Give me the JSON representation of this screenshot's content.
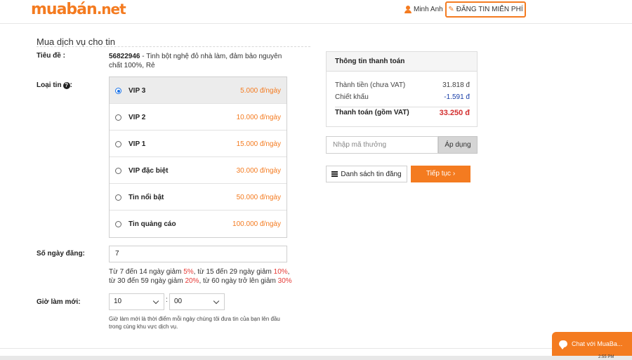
{
  "header": {
    "logo_main": "muabán",
    "logo_tld": ".net",
    "user_name": "Minh Anh",
    "post_button": "ĐĂNG TIN MIỄN PHÍ"
  },
  "page": {
    "title": "Mua dịch vụ cho tin"
  },
  "form": {
    "title_label": "Tiêu đề :",
    "title_id": "56822946",
    "title_text": " - Tinh bột nghệ đỏ nhà làm, đảm bảo nguyên chất 100%, Rẻ",
    "type_label": "Loại tin",
    "options": [
      {
        "name": "VIP 3",
        "price": "5.000 đ/ngày",
        "selected": true
      },
      {
        "name": "VIP 2",
        "price": "10.000 đ/ngày",
        "selected": false
      },
      {
        "name": "VIP 1",
        "price": "15.000 đ/ngày",
        "selected": false
      },
      {
        "name": "VIP đặc biệt",
        "price": "30.000 đ/ngày",
        "selected": false
      },
      {
        "name": "Tin nổi bật",
        "price": "50.000 đ/ngày",
        "selected": false
      },
      {
        "name": "Tin quảng cáo",
        "price": "100.000 đ/ngày",
        "selected": false
      }
    ],
    "days_label": "Số ngày đăng:",
    "days_value": "7",
    "discount": {
      "t1": "Từ 7 đến 14 ngày giảm ",
      "p1": "5%",
      "t2": ", từ 15 đến 29 ngày giảm ",
      "p2": "10%",
      "t3": ", từ 30 đến 59 ngày giảm ",
      "p3": "20%",
      "t4": ", từ 60 ngày trở lên giảm ",
      "p4": "30%"
    },
    "refresh_label": "Giờ làm mới:",
    "hour_value": "10",
    "minute_value": "00",
    "colon": ":",
    "refresh_note": "Giờ làm mới là thời điểm mỗi ngày chúng tôi đưa tin của bạn lên đầu trong cùng khu vực dịch vụ."
  },
  "payment": {
    "heading": "Thông tin thanh toán",
    "subtotal_label": "Thành tiền (chưa VAT)",
    "subtotal_value": "31.818 đ",
    "discount_label": "Chiết khấu",
    "discount_value": "-1.591 đ",
    "total_label": "Thanh toán (gồm VAT)",
    "total_value": "33.250 đ",
    "coupon_placeholder": "Nhập mã thưởng",
    "apply_button": "Áp dụng",
    "list_button": "Danh sách tin đăng",
    "next_button": "Tiếp tục ›"
  },
  "chat": {
    "label": "Chat với MuaBa..."
  },
  "taskbar": {
    "time": "2:55 PM"
  },
  "colors": {
    "accent": "#f47b20",
    "discount_red": "#e53935",
    "total_red": "#d32f2f",
    "radio_blue": "#1a73e8"
  }
}
